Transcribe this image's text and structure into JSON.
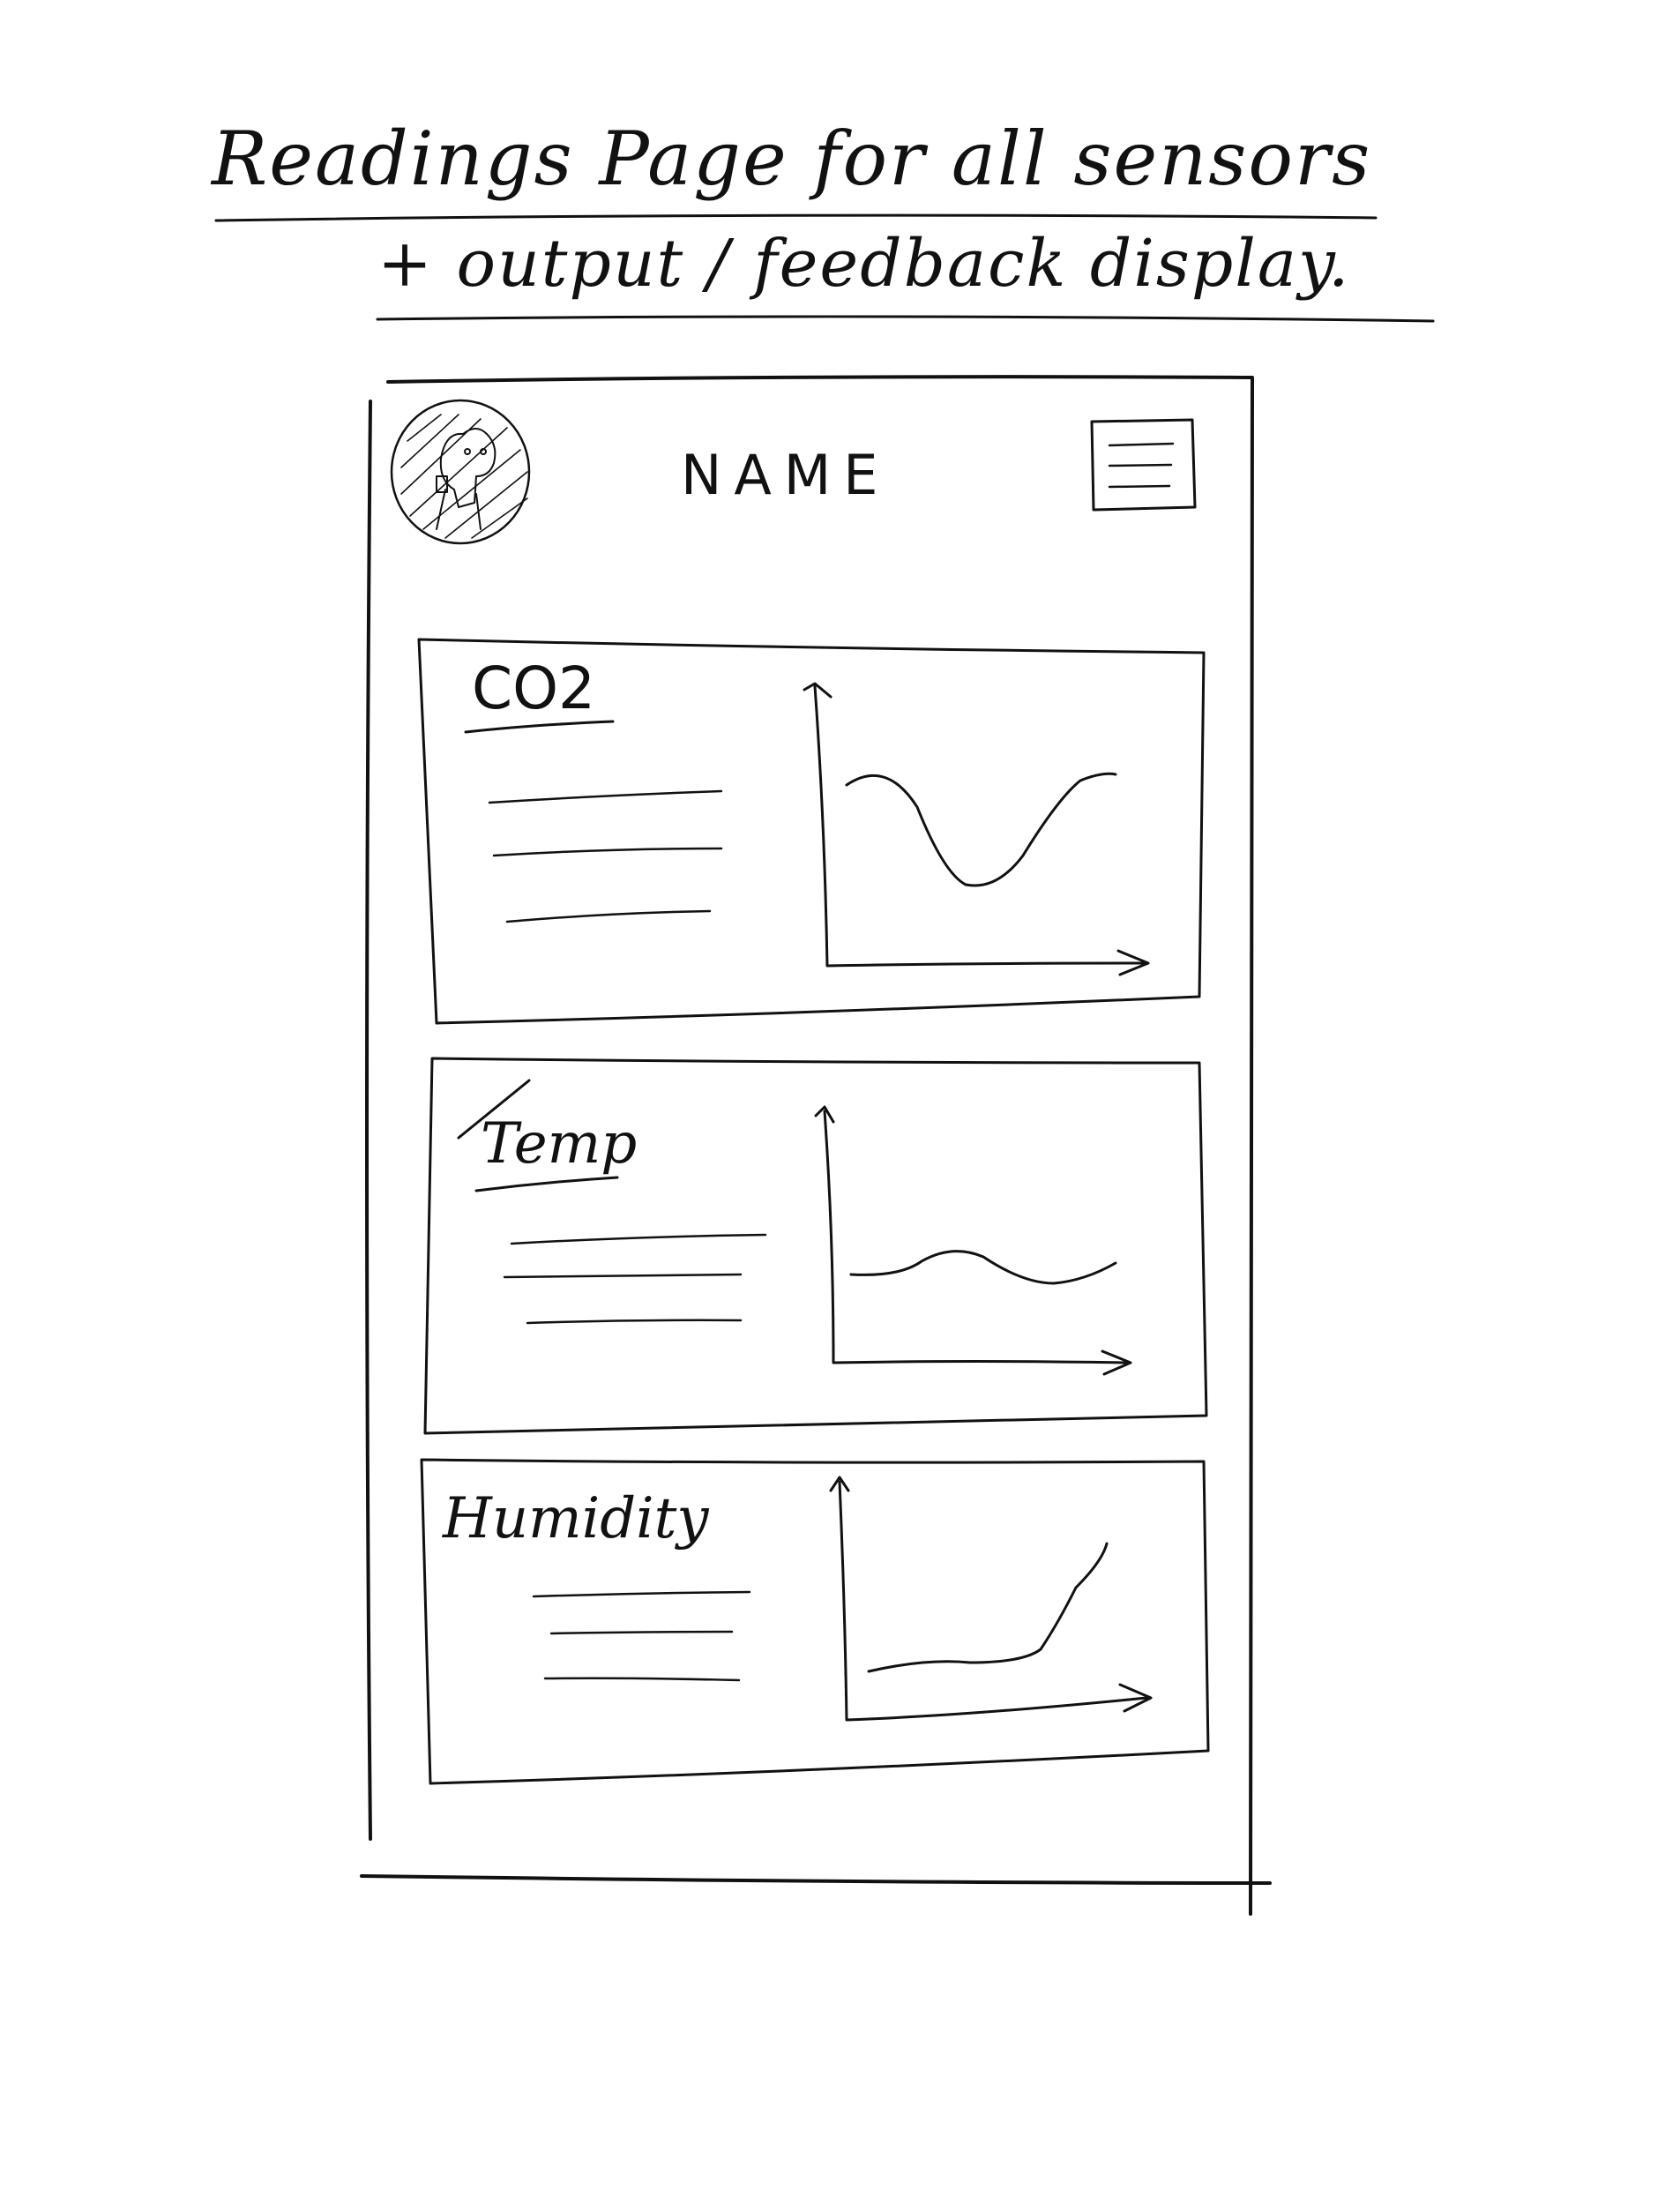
{
  "heading": {
    "line1": "Readings Page for all sensors",
    "line2": "+ output / feedback display."
  },
  "app": {
    "title": "NAME",
    "logo_icon": "dog-avatar-icon",
    "menu_icon": "hamburger-menu-icon"
  },
  "cards": [
    {
      "title": "CO2",
      "chart_shape": "dip-then-rise"
    },
    {
      "title": "Temp",
      "chart_shape": "gentle-wave"
    },
    {
      "title": "Humidity",
      "chart_shape": "flat-then-rise"
    }
  ],
  "colors": {
    "ink": "#111111",
    "paper": "#ffffff"
  }
}
